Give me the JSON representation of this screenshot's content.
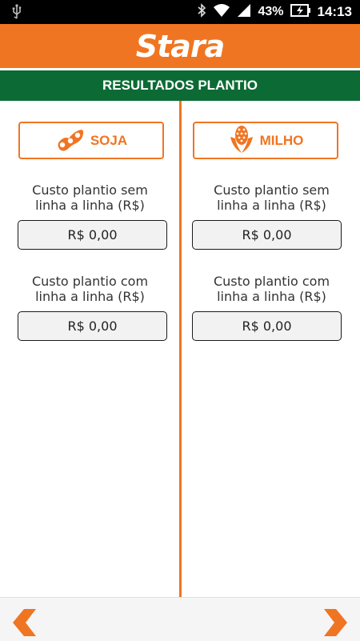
{
  "statusbar": {
    "battery": "43%",
    "time": "14:13"
  },
  "brand": {
    "logo_text": "Stara",
    "page_title": "RESULTADOS PLANTIO"
  },
  "colors": {
    "accent": "#f07522",
    "title_bar": "#0c6b34"
  },
  "columns": [
    {
      "crop": "SOJA",
      "icon": "soybean-icon",
      "fields": [
        {
          "label": "Custo plantio sem\nlinha a linha (R$)",
          "value": "R$ 0,00"
        },
        {
          "label": "Custo plantio com\nlinha a linha (R$)",
          "value": "R$ 0,00"
        }
      ]
    },
    {
      "crop": "MILHO",
      "icon": "corn-icon",
      "fields": [
        {
          "label": "Custo plantio sem\nlinha a linha (R$)",
          "value": "R$ 0,00"
        },
        {
          "label": "Custo plantio com\nlinha a linha (R$)",
          "value": "R$ 0,00"
        }
      ]
    }
  ],
  "navigation": {
    "prev_icon": "chevron-left-icon",
    "next_icon": "chevron-right-icon"
  }
}
